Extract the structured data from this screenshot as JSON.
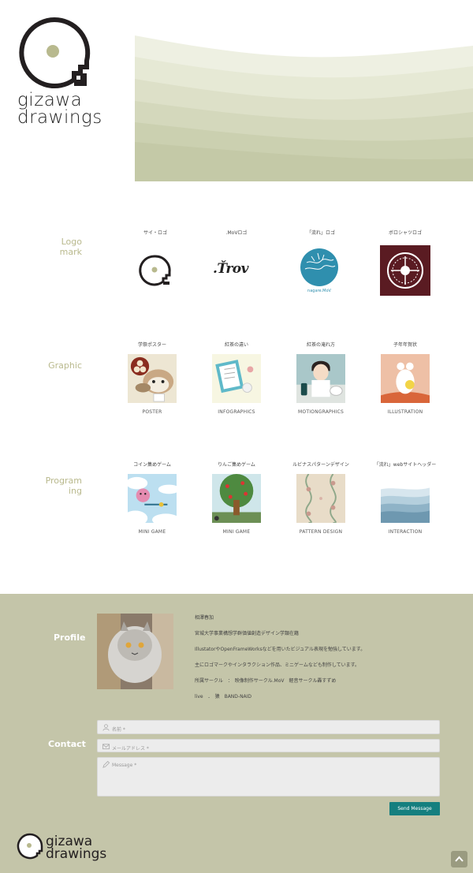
{
  "brand": {
    "line1": "gizawa",
    "line2": "drawings"
  },
  "sections": {
    "logo": {
      "label_line1": "Logo",
      "label_line2": "mark",
      "items": [
        {
          "title": "サイ・ロゴ",
          "category": ""
        },
        {
          "title": ".MoVロゴ",
          "category": ""
        },
        {
          "title": "「流れ」ロゴ",
          "category": ""
        },
        {
          "title": "ボロシャツロゴ",
          "category": ""
        }
      ],
      "movtext": ".Ťrov",
      "nagare_caption": "nagare.MoV"
    },
    "graphic": {
      "label": "Graphic",
      "items": [
        {
          "title": "学祭ポスター",
          "category": "POSTER"
        },
        {
          "title": "紅茶の違い",
          "category": "INFOGRAPHICS"
        },
        {
          "title": "紅茶の淹れ方",
          "category": "MOTIONGRAPHICS"
        },
        {
          "title": "子年年賀状",
          "category": "ILLUSTRATION"
        }
      ]
    },
    "programming": {
      "label_line1": "Program",
      "label_line2": "ing",
      "items": [
        {
          "title": "コイン集めゲーム",
          "category": "MINI GAME"
        },
        {
          "title": "りんご集めゲーム",
          "category": "MINI GAME"
        },
        {
          "title": "ルビナスパターンデザイン",
          "category": "PATTERN DESIGN"
        },
        {
          "title": "「流れ」webサイトヘッダー",
          "category": "INTERACTION"
        }
      ]
    }
  },
  "profile": {
    "label": "Profile",
    "lines": [
      "相澤春加",
      "宮城大学事業構想学群価値創造デザイン学類在籍",
      "IllustatorやOpenFrameWorksなどを用いたビジュアル表現を勉強しています。",
      "主にロゴマークやインタラクション作品、ミニゲームなども制作しています。",
      "所属サークル　：　映像制作サークル.MoV　軽音サークル轟すずめ",
      "live　．　猿　BAND-NAID"
    ]
  },
  "contact": {
    "label": "Contact",
    "name_placeholder": "名前 *",
    "email_placeholder": "メールアドレス *",
    "message_placeholder": "Message *",
    "send_label": "Send Message"
  },
  "colors": {
    "accent_green": "#b9b98d",
    "footer_bg": "#c4c5a9",
    "send_button": "#157f7f",
    "logo_maroon": "#5a1b22",
    "nagare_blue": "#2f8fae"
  },
  "icons": {
    "user": "user-icon",
    "mail": "mail-icon",
    "pencil": "pencil-icon",
    "scroll_top": "chevron-up-icon"
  }
}
